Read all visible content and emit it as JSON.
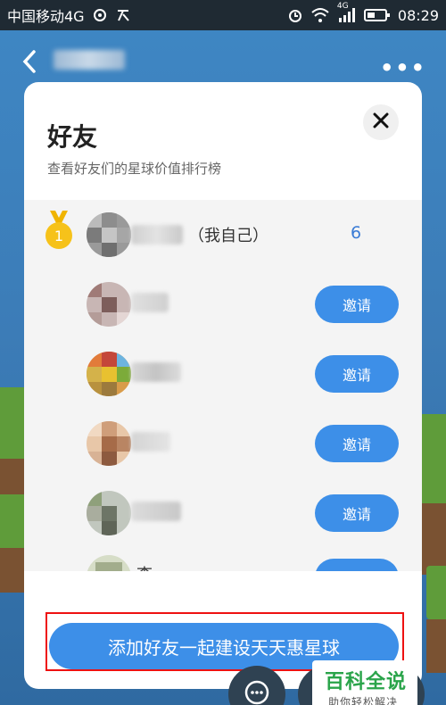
{
  "status_bar": {
    "carrier": "中国移动4G",
    "network": "4G",
    "time": "08:29"
  },
  "modal": {
    "title": "好友",
    "subtitle": "查看好友们的星球价值排行榜",
    "close_icon": "close-icon"
  },
  "friends": [
    {
      "rank": "1",
      "self_label": "（我自己）",
      "score": "6"
    },
    {
      "invite_label": "邀请"
    },
    {
      "invite_label": "邀请"
    },
    {
      "invite_label": "邀请"
    },
    {
      "invite_label": "邀请"
    },
    {
      "partial_name": "李",
      "invite_label": "邀请"
    }
  ],
  "add_friends_button": "添加好友一起建设天天惠星球",
  "watermark": {
    "title": "百科全说",
    "subtitle": "助你轻松解决"
  },
  "colors": {
    "accent": "#3d8fe8",
    "highlight_frame": "#e11111",
    "score": "#3a7bd5"
  }
}
